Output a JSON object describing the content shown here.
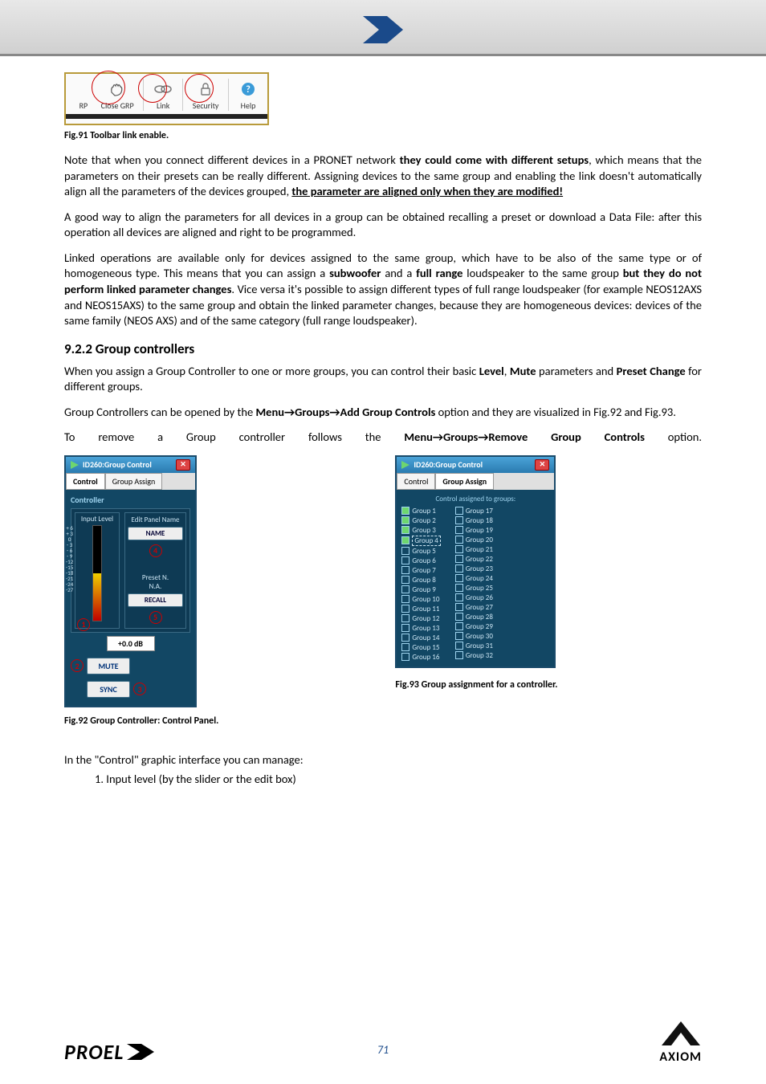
{
  "toolbar": {
    "items": [
      "RP",
      "Close GRP",
      "Link",
      "Security",
      "Help"
    ]
  },
  "captions": {
    "fig91": "Fig.91 Toolbar link enable.",
    "fig92": "Fig.92 Group Controller: Control Panel.",
    "fig93": "Fig.93 Group assignment for a controller."
  },
  "para1": {
    "a": "Note that when you connect different devices in a PRONET network ",
    "b": "they could come with different setups",
    "c": ", which means that the parameters on their presets can be really different. Assigning devices to the same group and enabling the link doesn't automatically align all the parameters of the devices grouped, ",
    "d": "the parameter are aligned only when they are modified!"
  },
  "para2": "A good way to align the parameters for all devices in a group can be obtained recalling a preset or download a Data File: after this operation all devices are aligned and right to be programmed.",
  "para3": {
    "a": "Linked operations are available only for devices assigned to the same group, which have to be also of the same type or of homogeneous type. This means that you can assign a ",
    "b": "subwoofer",
    "c": " and a ",
    "d": "full range",
    "e": " loudspeaker to the same group ",
    "f": "but they do not perform linked parameter changes",
    "g": ". Vice versa it's possible to assign different types of full range loudspeaker (for example NEOS12AXS and NEOS15AXS) to the same group and obtain the linked parameter changes, because they are homogeneous devices: devices of the same family (NEOS AXS) and of the same category (full range loudspeaker)."
  },
  "section": "9.2.2  Group controllers",
  "para4": {
    "a": "When you assign a Group Controller to one or more groups, you can control their basic ",
    "b": "Level",
    "c": ", ",
    "d": "Mute",
    "e": " parameters and ",
    "f": "Preset Change",
    "g": " for different groups."
  },
  "para5": {
    "a": "Group Controllers can be opened by the ",
    "b": "Menu→Groups→Add Group Controls",
    "c": " option and they are visualized in Fig.92 and Fig.93."
  },
  "para6": {
    "a": "To remove a Group controller follows the ",
    "b": "Menu→Groups→Remove Group Controls",
    "c": " option."
  },
  "dlg": {
    "title": "ID260:Group Control",
    "tab_control": "Control",
    "tab_assign": "Group Assign",
    "controller_heading": "Controller",
    "input_level": "Input Level",
    "scale": [
      "+ 6",
      "+ 3",
      "0",
      "- 3",
      "- 6",
      "- 9",
      "-12",
      "-15",
      "-18",
      "-21",
      "-24",
      "-27"
    ],
    "edit_panel": "Edit Panel Name",
    "name_btn": "NAME",
    "preset_n": "Preset N.",
    "na": "N.A.",
    "recall_btn": "RECALL",
    "level_value": "+0.0 dB",
    "mute": "MUTE",
    "sync": "SYNC",
    "ann": {
      "n1": "1",
      "n2": "2",
      "n3": "3",
      "n4": "4",
      "n5": "5"
    }
  },
  "ga": {
    "heading": "Control assigned to groups:",
    "left": [
      "Group 1",
      "Group 2",
      "Group 3",
      "Group 4",
      "Group 5",
      "Group 6",
      "Group 7",
      "Group 8",
      "Group 9",
      "Group 10",
      "Group 11",
      "Group 12",
      "Group 13",
      "Group 14",
      "Group 15",
      "Group 16"
    ],
    "right": [
      "Group 17",
      "Group 18",
      "Group 19",
      "Group 20",
      "Group 21",
      "Group 22",
      "Group 23",
      "Group 24",
      "Group 25",
      "Group 26",
      "Group 27",
      "Group 28",
      "Group 29",
      "Group 30",
      "Group 31",
      "Group 32"
    ],
    "checked_left": [
      true,
      true,
      true,
      true,
      false,
      false,
      false,
      false,
      false,
      false,
      false,
      false,
      false,
      false,
      false,
      false
    ]
  },
  "list_lead": "In the \"Control\" graphic interface you can manage:",
  "list_item1": "1.    Input level (by the slider or the edit box)",
  "page_number": "71",
  "logo_proel": "PROEL",
  "logo_axiom": "AXIOM"
}
